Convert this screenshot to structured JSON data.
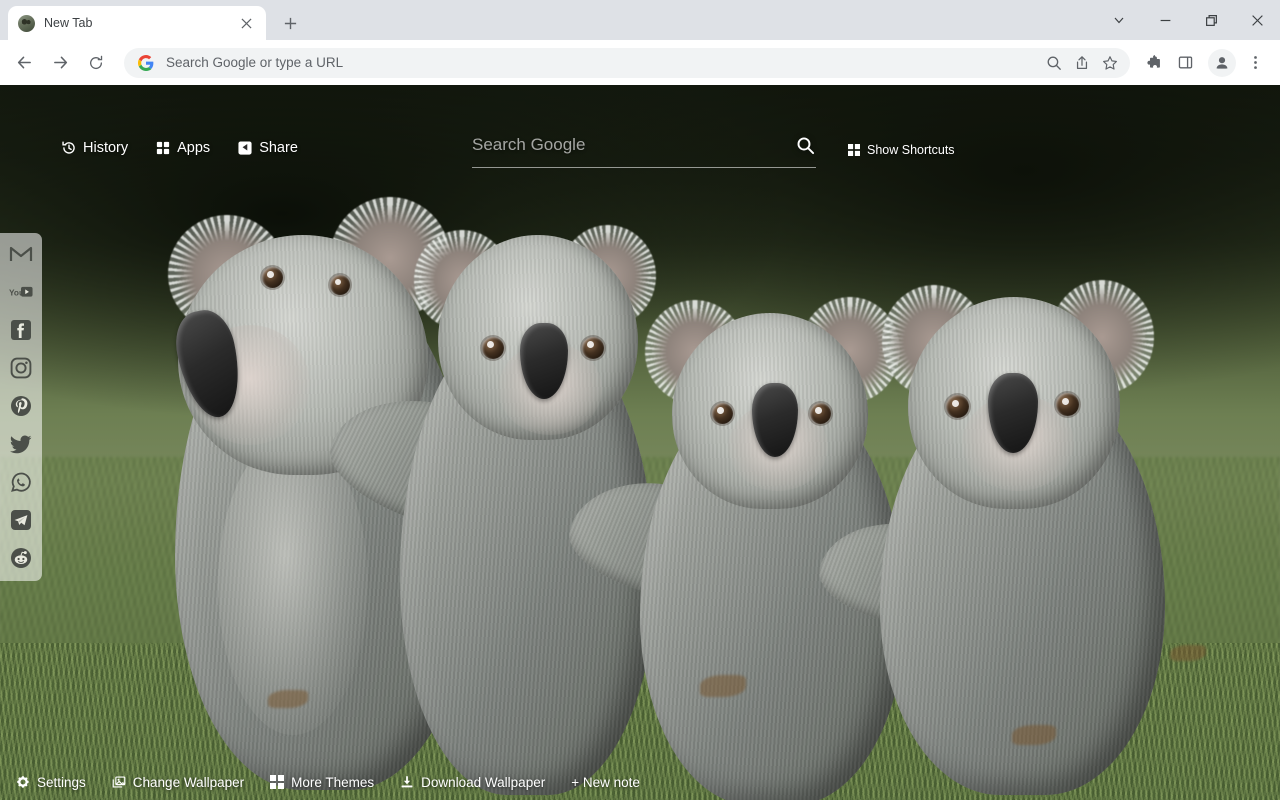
{
  "window": {
    "controls": [
      {
        "name": "tab-search",
        "icon": "chevron-down-icon",
        "label": "Search tabs"
      },
      {
        "name": "minimize",
        "icon": "minimize-icon",
        "label": "Minimize"
      },
      {
        "name": "maximize",
        "icon": "restore-icon",
        "label": "Maximize"
      },
      {
        "name": "close",
        "icon": "close-icon",
        "label": "Close"
      }
    ]
  },
  "tabstrip": {
    "tabs": [
      {
        "title": "New Tab",
        "favicon": "koala-favicon",
        "close_label": "Close tab"
      }
    ],
    "new_tab_label": "New tab"
  },
  "toolbar": {
    "back_label": "Back",
    "forward_label": "Forward",
    "reload_label": "Reload",
    "omnibox": {
      "placeholder": "Search Google or type a URL",
      "value": "",
      "leading_icon": "google-g-icon"
    },
    "actions": [
      {
        "name": "zoom-search-icon",
        "label": "Search"
      },
      {
        "name": "share-icon",
        "label": "Share this page"
      },
      {
        "name": "bookmark-star-icon",
        "label": "Bookmark this tab"
      }
    ],
    "right_icons": [
      {
        "name": "extensions-puzzle-icon",
        "label": "Extensions"
      },
      {
        "name": "side-panel-icon",
        "label": "Side panel"
      },
      {
        "name": "profile-avatar-icon",
        "label": "Profile"
      },
      {
        "name": "chrome-menu-icon",
        "label": "Customize and control Google Chrome"
      }
    ]
  },
  "newtab": {
    "quick_links": [
      {
        "label": "History",
        "icon": "history-clock-icon"
      },
      {
        "label": "Apps",
        "icon": "apps-grid-icon"
      },
      {
        "label": "Share",
        "icon": "share-node-icon"
      }
    ],
    "search": {
      "placeholder": "Search Google",
      "value": "",
      "submit_icon": "magnifier-icon"
    },
    "shortcuts_toggle": {
      "label": "Show Shortcuts",
      "icon": "grid-squares-icon"
    },
    "dock": [
      {
        "label": "Gmail",
        "icon": "gmail-icon"
      },
      {
        "label": "YouTube",
        "icon": "youtube-icon"
      },
      {
        "label": "Facebook",
        "icon": "facebook-icon"
      },
      {
        "label": "Instagram",
        "icon": "instagram-icon"
      },
      {
        "label": "Pinterest",
        "icon": "pinterest-icon"
      },
      {
        "label": "Twitter",
        "icon": "twitter-bird-icon"
      },
      {
        "label": "WhatsApp",
        "icon": "whatsapp-icon"
      },
      {
        "label": "Telegram",
        "icon": "telegram-icon"
      },
      {
        "label": "Reddit",
        "icon": "reddit-icon"
      }
    ],
    "bottom_bar": [
      {
        "label": "Settings",
        "icon": "gear-icon"
      },
      {
        "label": "Change Wallpaper",
        "icon": "photos-stack-icon"
      },
      {
        "label": "More Themes",
        "icon": "grid-squares-icon"
      },
      {
        "label": "Download Wallpaper",
        "icon": "download-icon"
      },
      {
        "label": "+ New note",
        "icon": "plus-icon"
      }
    ],
    "wallpaper": {
      "subject": "four koalas sitting together on grass",
      "colors": {
        "background_dark": "#141a0f",
        "background_green": "#79895e",
        "grass": "#6a7d52",
        "fur_light": "#b9bcb6",
        "fur_dark": "#61665f",
        "nose": "#1e1e1e"
      }
    }
  }
}
